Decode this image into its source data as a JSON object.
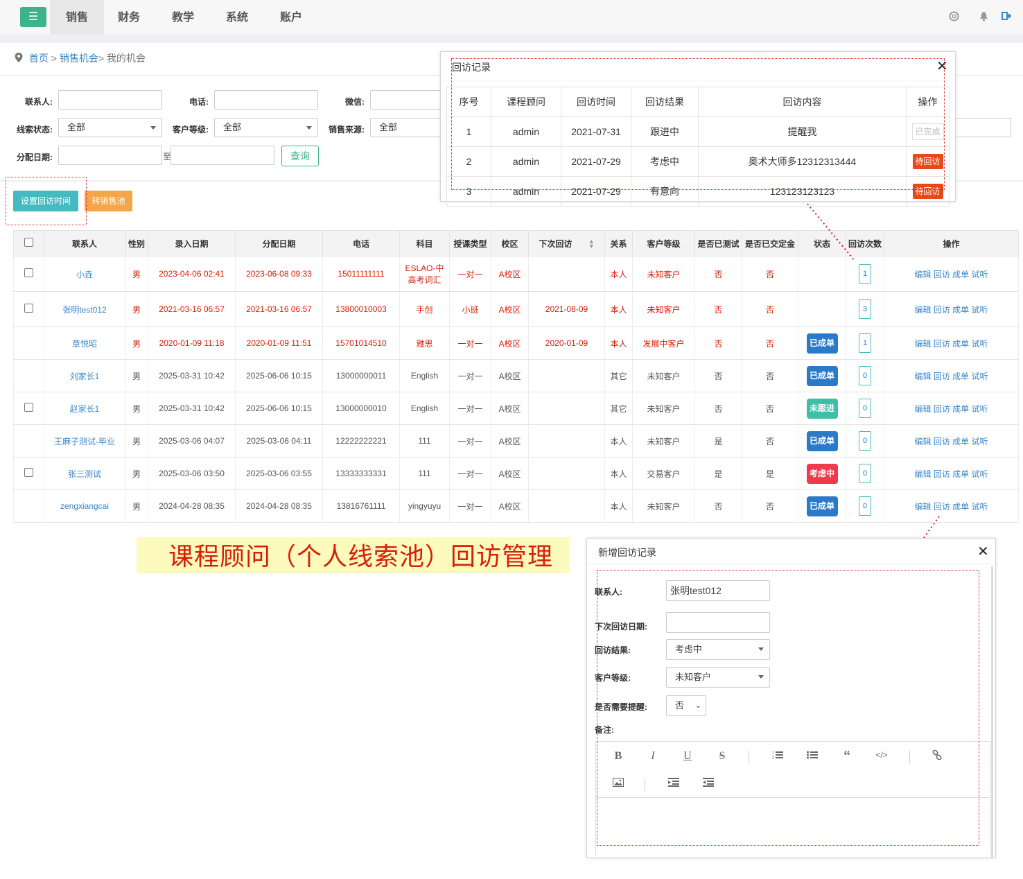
{
  "nav": {
    "menu_icon": "menu-icon",
    "tabs": [
      {
        "label": "销售",
        "active": true
      },
      {
        "label": "财务"
      },
      {
        "label": "教学"
      },
      {
        "label": "系统"
      },
      {
        "label": "账户"
      }
    ],
    "icons": [
      "help-icon",
      "bell-icon",
      "logout-icon"
    ]
  },
  "breadcrumb": {
    "home": "首页",
    "sep1": " > ",
    "opps": "销售机会",
    "sep2": "> ",
    "current": "我的机会"
  },
  "filters": {
    "contact_label": "联系人:",
    "phone_label": "电话:",
    "wechat_label": "微信:",
    "clue_status_label": "线索状态:",
    "clue_status_value": "全部",
    "customer_level_label": "客户等级:",
    "customer_level_value": "全部",
    "source_label": "销售来源:",
    "source_value": "全部",
    "assign_date_label": "分配日期:",
    "to_label": "至",
    "query_button": "查询"
  },
  "actions": {
    "set_visit_time": "设置回访时间",
    "transfer_pool": "转销售池"
  },
  "table": {
    "headers": [
      "联系人",
      "性别",
      "录入日期",
      "分配日期",
      "电话",
      "科目",
      "授课类型",
      "校区",
      "下次回访",
      "关系",
      "客户等级",
      "是否已测试",
      "是否已交定金",
      "状态",
      "回访次数",
      "操作"
    ],
    "ops": {
      "edit": "编辑",
      "visit": "回访",
      "deal": "成单",
      "trial": "试听"
    },
    "rows": [
      {
        "check": true,
        "name": "小垚",
        "gender": "男",
        "entry": "2023-04-06 02:41",
        "assign": "2023-06-08 09:33",
        "phone": "15011111111",
        "subject": "ESLAO-中高考词汇",
        "type": "一对一",
        "campus": "A校区",
        "next": "",
        "relation": "本人",
        "level": "未知客户",
        "tested": "否",
        "deposit": "否",
        "status": "",
        "status_color": "",
        "count": "1",
        "red": true
      },
      {
        "check": true,
        "name": "张明test012",
        "gender": "男",
        "entry": "2021-03-16 06:57",
        "assign": "2021-03-16 06:57",
        "phone": "13800010003",
        "subject": "手创",
        "type": "小班",
        "campus": "A校区",
        "next": "2021-08-09",
        "relation": "本人",
        "level": "未知客户",
        "tested": "否",
        "deposit": "否",
        "status": "",
        "status_color": "",
        "count": "3",
        "red": true
      },
      {
        "check": false,
        "name": "章悦昭",
        "gender": "男",
        "entry": "2020-01-09 11:18",
        "assign": "2020-01-09 11:51",
        "phone": "15701014510",
        "subject": "雅思",
        "type": "一对一",
        "campus": "A校区",
        "next": "2020-01-09",
        "relation": "本人",
        "level": "发展中客户",
        "tested": "否",
        "deposit": "否",
        "status": "已成单",
        "status_color": "blue",
        "count": "1",
        "red": true
      },
      {
        "check": false,
        "name": "刘家长1",
        "gender": "男",
        "entry": "2025-03-31 10:42",
        "assign": "2025-06-06 10:15",
        "phone": "13000000011",
        "subject": "English",
        "type": "一对一",
        "campus": "A校区",
        "next": "",
        "relation": "其它",
        "level": "未知客户",
        "tested": "否",
        "deposit": "否",
        "status": "已成单",
        "status_color": "blue",
        "count": "0",
        "red": false
      },
      {
        "check": true,
        "name": "赵家长1",
        "gender": "男",
        "entry": "2025-03-31 10:42",
        "assign": "2025-06-06 10:15",
        "phone": "13000000010",
        "subject": "English",
        "type": "一对一",
        "campus": "A校区",
        "next": "",
        "relation": "其它",
        "level": "未知客户",
        "tested": "否",
        "deposit": "否",
        "status": "未跟进",
        "status_color": "teal",
        "count": "0",
        "red": false
      },
      {
        "check": false,
        "name": "王麻子测试-毕业",
        "gender": "男",
        "entry": "2025-03-06 04:07",
        "assign": "2025-03-06 04:11",
        "phone": "12222222221",
        "subject": "111",
        "type": "一对一",
        "campus": "A校区",
        "next": "",
        "relation": "本人",
        "level": "未知客户",
        "tested": "是",
        "deposit": "否",
        "status": "已成单",
        "status_color": "blue",
        "count": "0",
        "red": false
      },
      {
        "check": true,
        "name": "张三测试",
        "gender": "男",
        "entry": "2025-03-06 03:50",
        "assign": "2025-03-06 03:55",
        "phone": "13333333331",
        "subject": "111",
        "type": "一对一",
        "campus": "A校区",
        "next": "",
        "relation": "本人",
        "level": "交易客户",
        "tested": "是",
        "deposit": "是",
        "status": "考虑中",
        "status_color": "red",
        "count": "0",
        "red": false
      },
      {
        "check": false,
        "name": "zengxiangcai",
        "gender": "男",
        "entry": "2024-04-28 08:35",
        "assign": "2024-04-28 08:35",
        "phone": "13816761111",
        "subject": "yingyuyu",
        "type": "一对一",
        "campus": "A校区",
        "next": "",
        "relation": "本人",
        "level": "未知客户",
        "tested": "否",
        "deposit": "否",
        "status": "已成单",
        "status_color": "blue",
        "count": "0",
        "red": false
      }
    ]
  },
  "caption": "课程顾问（个人线索池）回访管理",
  "visit_popup": {
    "title": "回访记录",
    "headers": [
      "序号",
      "课程顾问",
      "回访时间",
      "回访结果",
      "回访内容",
      "操作"
    ],
    "rows": [
      {
        "no": "1",
        "advisor": "admin",
        "time": "2021-07-31",
        "result": "跟进中",
        "content": "提醒我",
        "op": "已完成",
        "done": true
      },
      {
        "no": "2",
        "advisor": "admin",
        "time": "2021-07-29",
        "result": "考虑中",
        "content": "奥术大师多12312313444",
        "op": "待回访",
        "done": false
      },
      {
        "no": "3",
        "advisor": "admin",
        "time": "2021-07-29",
        "result": "有意向",
        "content": "123123123123",
        "op": "待回访",
        "done": false
      }
    ]
  },
  "new_visit": {
    "title": "新增回访记录",
    "contact_label": "联系人:",
    "contact_value": "张明test012",
    "next_date_label": "下次回访日期:",
    "result_label": "回访结果:",
    "result_value": "考虑中",
    "level_label": "客户等级:",
    "level_value": "未知客户",
    "remind_label": "是否需要提醒:",
    "remind_value": "否",
    "note_label": "备注:"
  },
  "colors": {
    "accent": "#3cb38a",
    "link": "#3b87c8",
    "red_text": "#d81e06",
    "badge_blue": "#2a7ac7",
    "badge_teal": "#3cbfa4",
    "badge_red": "#ee3a4c",
    "wait_orange": "#e8491a"
  }
}
